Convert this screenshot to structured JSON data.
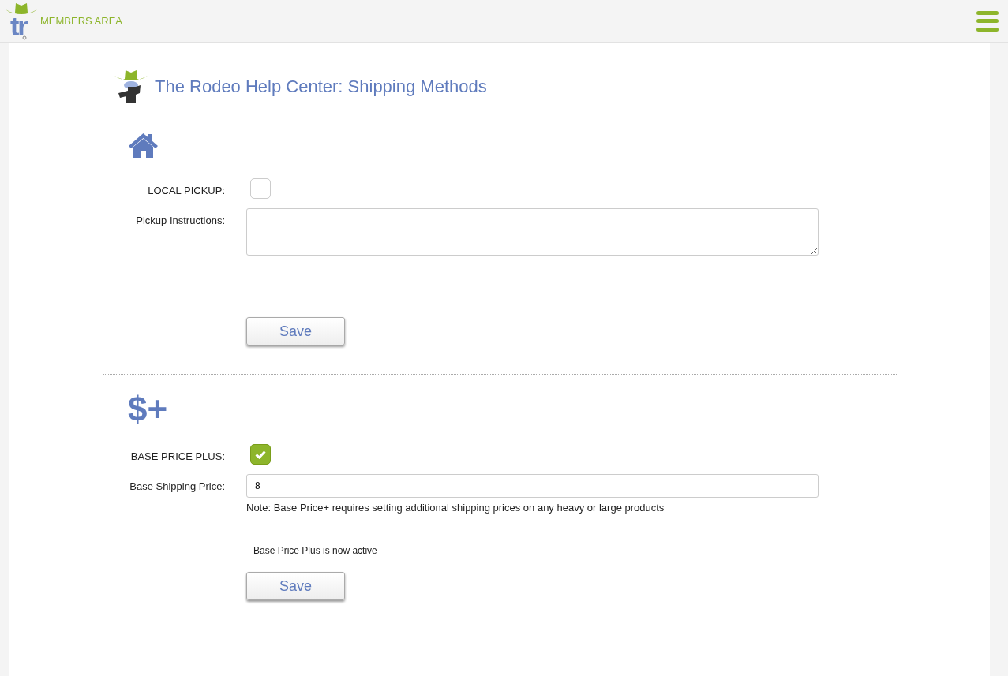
{
  "header": {
    "logo_text": "tr",
    "title": "MEMBERS AREA"
  },
  "page_title": "The Rodeo Help Center: Shipping Methods",
  "sections": [
    {
      "fields": [
        {
          "kind": "checkbox",
          "label": "LOCAL PICKUP:",
          "checked": false
        },
        {
          "kind": "textarea",
          "label": "Pickup Instructions:"
        }
      ],
      "button": "Save"
    },
    {
      "icon_text": "$+",
      "fields": [
        {
          "kind": "checkbox",
          "label": "BASE PRICE PLUS:",
          "checked": true
        },
        {
          "kind": "text",
          "label": "Base Shipping Price:",
          "value": "8",
          "note": "Note: Base Price+ requires setting additional shipping prices on any heavy or large products"
        }
      ],
      "status": "Base Price Plus is now active",
      "button": "Save"
    }
  ]
}
